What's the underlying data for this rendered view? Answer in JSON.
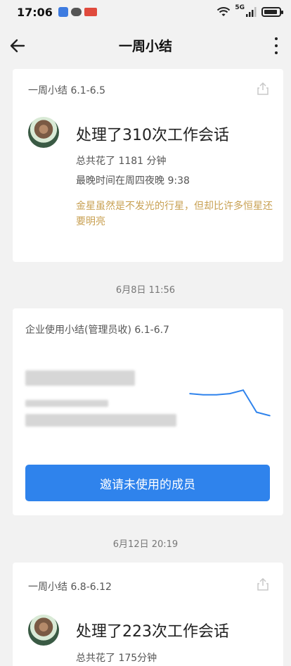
{
  "status": {
    "time": "17:06",
    "network": "5G"
  },
  "nav": {
    "title": "一周小结"
  },
  "card1": {
    "header": "一周小结 6.1-6.5",
    "headline": "处理了310次工作会话",
    "total": "总共花了 1181 分钟",
    "latest": "最晚时间在周四夜晚 9:38",
    "quote": "金星虽然是不发光的行星，但却比许多恒星还要明亮"
  },
  "ts1": "6月8日  11:56",
  "card2": {
    "header": "企业使用小结(管理员收) 6.1-6.7",
    "button_label": "邀请未使用的成员",
    "chart_data": {
      "type": "line",
      "series": [
        {
          "values": [
            52,
            50,
            50,
            52,
            58,
            20,
            14
          ]
        }
      ],
      "ylim": [
        0,
        80
      ]
    },
    "line_color": "#2f83ec"
  },
  "ts2": "6月12日  20:19",
  "card3": {
    "header": "一周小结 6.8-6.12",
    "headline": "处理了223次工作会话",
    "total": "总共花了 175分钟"
  }
}
